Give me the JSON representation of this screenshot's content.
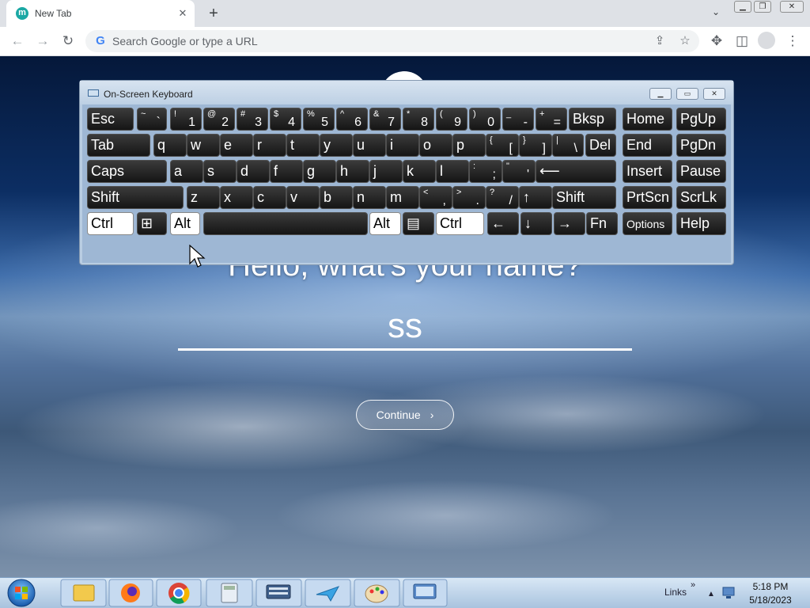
{
  "browser": {
    "tab_title": "New Tab",
    "tab_favicon": "m",
    "new_tab_symbol": "+",
    "address_placeholder": "Search Google or type a URL"
  },
  "page": {
    "question": "Hello, what's your name?",
    "name_value": "ss",
    "continue_label": "Continue",
    "continue_arrow": "›"
  },
  "osk": {
    "title": "On-Screen Keyboard",
    "rows": [
      [
        {
          "label": "Esc"
        },
        {
          "label": "`",
          "sub": "~"
        },
        {
          "label": "1",
          "sub": "!"
        },
        {
          "label": "2",
          "sub": "@"
        },
        {
          "label": "3",
          "sub": "#"
        },
        {
          "label": "4",
          "sub": "$"
        },
        {
          "label": "5",
          "sub": "%"
        },
        {
          "label": "6",
          "sub": "^"
        },
        {
          "label": "7",
          "sub": "&"
        },
        {
          "label": "8",
          "sub": "*"
        },
        {
          "label": "9",
          "sub": "("
        },
        {
          "label": "0",
          "sub": ")"
        },
        {
          "label": "-",
          "sub": "_"
        },
        {
          "label": "=",
          "sub": "+"
        },
        {
          "label": "Bksp"
        },
        {
          "label": "Home"
        },
        {
          "label": "PgUp"
        }
      ],
      [
        {
          "label": "Tab"
        },
        {
          "label": "q"
        },
        {
          "label": "w"
        },
        {
          "label": "e"
        },
        {
          "label": "r"
        },
        {
          "label": "t"
        },
        {
          "label": "y"
        },
        {
          "label": "u"
        },
        {
          "label": "i"
        },
        {
          "label": "o"
        },
        {
          "label": "p"
        },
        {
          "label": "[",
          "sub": "{"
        },
        {
          "label": "]",
          "sub": "}"
        },
        {
          "label": "\\",
          "sub": "|"
        },
        {
          "label": "Del"
        },
        {
          "label": "End"
        },
        {
          "label": "PgDn"
        }
      ],
      [
        {
          "label": "Caps"
        },
        {
          "label": "a"
        },
        {
          "label": "s"
        },
        {
          "label": "d"
        },
        {
          "label": "f"
        },
        {
          "label": "g"
        },
        {
          "label": "h"
        },
        {
          "label": "j"
        },
        {
          "label": "k"
        },
        {
          "label": "l"
        },
        {
          "label": ";",
          "sub": ":"
        },
        {
          "label": "'",
          "sub": "\""
        },
        {
          "label": "⟵"
        },
        {
          "label": "Insert"
        },
        {
          "label": "Pause"
        }
      ],
      [
        {
          "label": "Shift"
        },
        {
          "label": "z"
        },
        {
          "label": "x"
        },
        {
          "label": "c"
        },
        {
          "label": "v"
        },
        {
          "label": "b"
        },
        {
          "label": "n"
        },
        {
          "label": "m"
        },
        {
          "label": ",",
          "sub": "<"
        },
        {
          "label": ".",
          "sub": ">"
        },
        {
          "label": "/",
          "sub": "?"
        },
        {
          "label": "↑"
        },
        {
          "label": "Shift"
        },
        {
          "label": "PrtScn"
        },
        {
          "label": "ScrLk"
        }
      ],
      [
        {
          "label": "Ctrl",
          "state": "white"
        },
        {
          "label": "⊞"
        },
        {
          "label": "Alt",
          "state": "white"
        },
        {
          "label": ""
        },
        {
          "label": "Alt",
          "state": "white"
        },
        {
          "label": "▤"
        },
        {
          "label": "Ctrl",
          "state": "white"
        },
        {
          "label": "←"
        },
        {
          "label": "↓"
        },
        {
          "label": "→"
        },
        {
          "label": "Fn"
        },
        {
          "label": "Options"
        },
        {
          "label": "Help"
        }
      ]
    ]
  },
  "taskbar": {
    "links_label": "Links",
    "time": "5:18 PM",
    "date": "5/18/2023",
    "apps": [
      "file-explorer",
      "firefox",
      "chrome",
      "calculator",
      "keyboard",
      "messenger",
      "paint",
      "network"
    ]
  }
}
